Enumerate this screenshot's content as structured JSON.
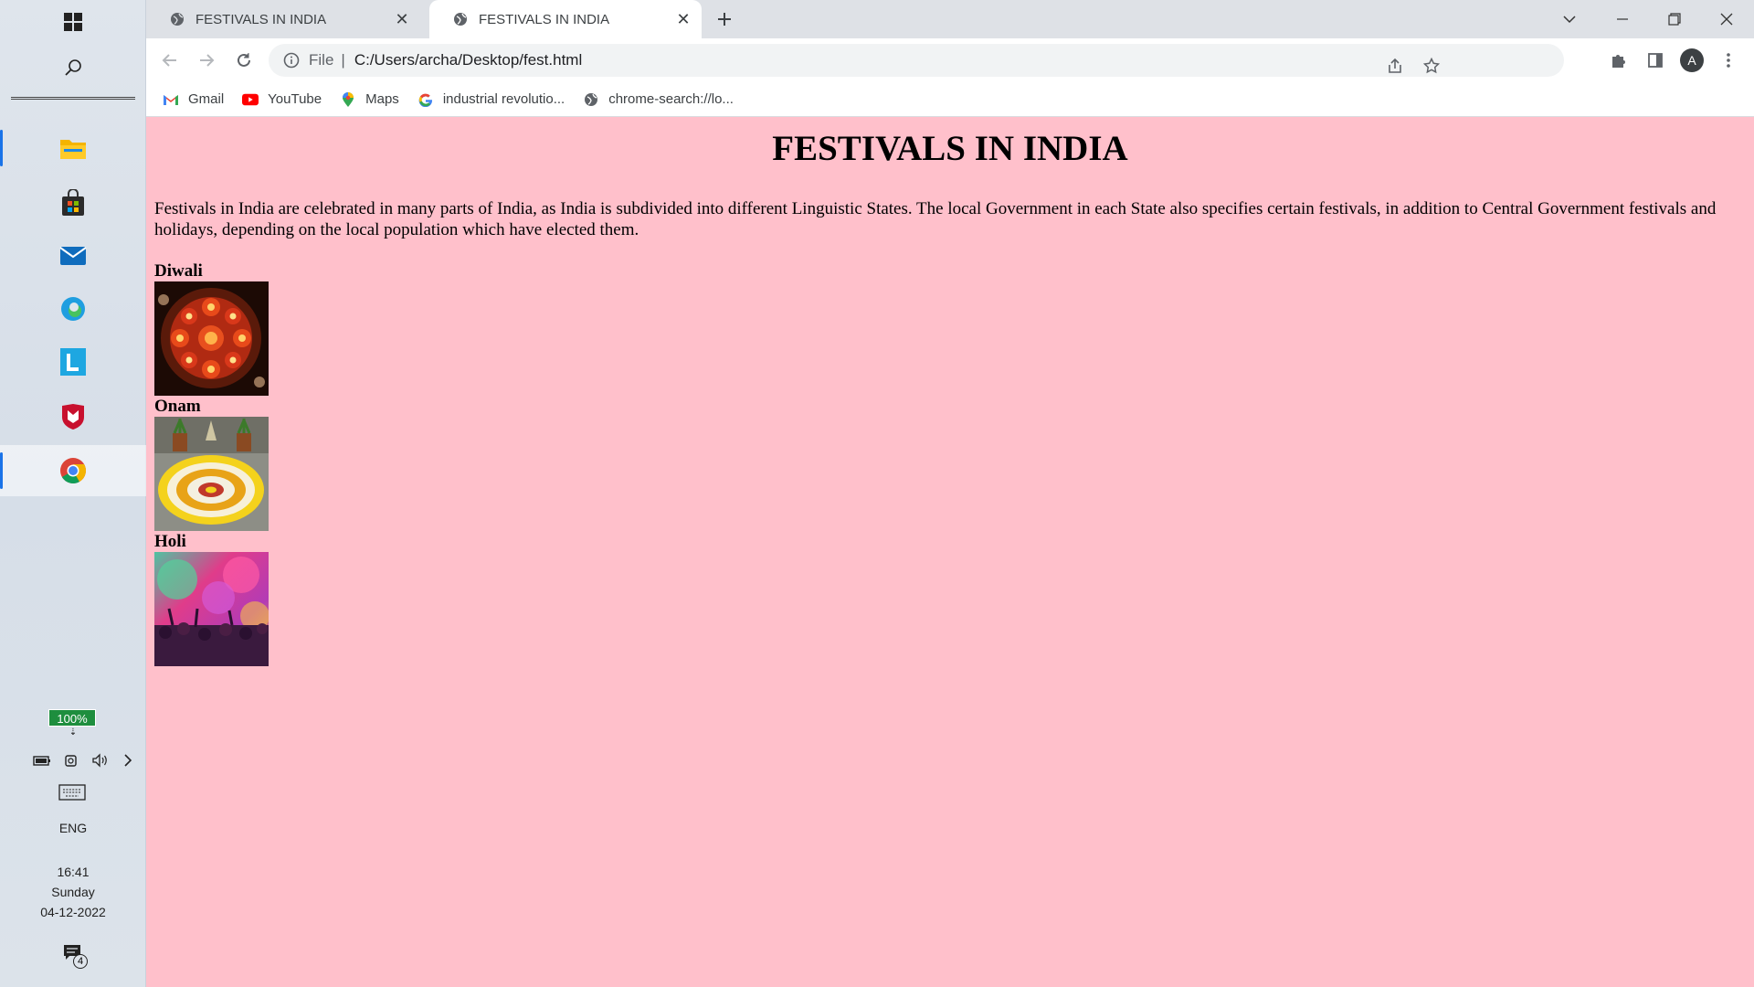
{
  "taskbar": {
    "battery": "100%",
    "language": "ENG",
    "time": "16:41",
    "day": "Sunday",
    "date": "04-12-2022",
    "notification_count": "4",
    "apps": [
      "file-explorer",
      "microsoft-store",
      "mail",
      "edge",
      "l-app",
      "mcafee",
      "chrome"
    ]
  },
  "browser": {
    "tabs": [
      {
        "title": "FESTIVALS IN INDIA",
        "active": false
      },
      {
        "title": "FESTIVALS IN INDIA",
        "active": true
      }
    ],
    "address": {
      "scheme": "File",
      "url": "C:/Users/archa/Desktop/fest.html"
    },
    "profile_initial": "A",
    "bookmarks": [
      {
        "label": "Gmail",
        "icon": "gmail-icon"
      },
      {
        "label": "YouTube",
        "icon": "youtube-icon"
      },
      {
        "label": "Maps",
        "icon": "maps-icon"
      },
      {
        "label": "industrial revolutio...",
        "icon": "google-icon"
      },
      {
        "label": "chrome-search://lo...",
        "icon": "globe-icon"
      }
    ]
  },
  "page": {
    "background": "#ffc0cb",
    "heading": "FESTIVALS IN INDIA",
    "intro": "Festivals in India are celebrated in many parts of India, as India is subdivided into different Linguistic States. The local Government in each State also specifies certain festivals, in addition to Central Government festivals and holidays, depending on the local population which have elected them.",
    "festivals": [
      {
        "name": "Diwali"
      },
      {
        "name": "Onam"
      },
      {
        "name": "Holi"
      }
    ]
  }
}
